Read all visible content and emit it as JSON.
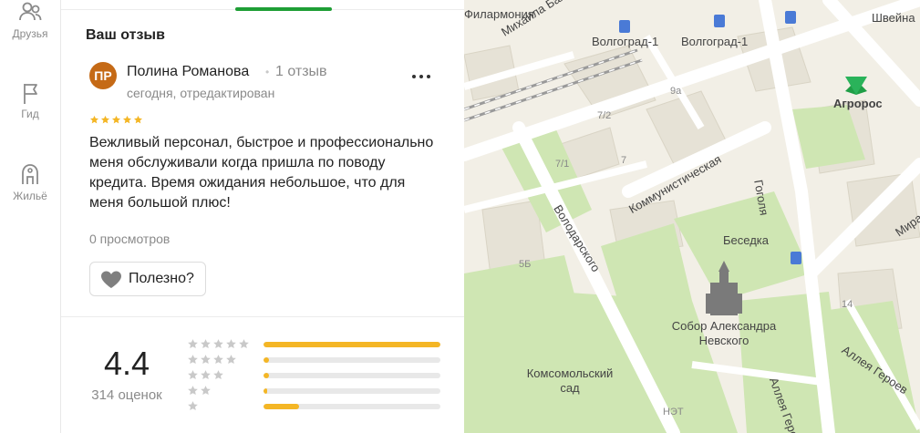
{
  "sidebar": {
    "items": [
      {
        "label": "Друзья",
        "icon": "friends-icon"
      },
      {
        "label": "Гид",
        "icon": "flag-icon"
      },
      {
        "label": "Жильё",
        "icon": "housing-icon"
      }
    ]
  },
  "review_section": {
    "title": "Ваш отзыв"
  },
  "review": {
    "avatar_initials": "ПР",
    "avatar_color": "#c56a16",
    "author": "Полина Романова",
    "author_reviews": "1 отзыв",
    "date": "сегодня, отредактирован",
    "stars": 5,
    "text": "Вежливый персонал, быстрое и профессионально меня обслуживали когда пришла по поводу кредита. Время ожидания небольшое, что для меня большой плюс!",
    "views": "0 просмотров",
    "helpful_label": "Полезно?"
  },
  "rating_summary": {
    "value": "4.4",
    "count_label": "314 оценок",
    "distribution": [
      {
        "stars": 5,
        "fraction": 1.0
      },
      {
        "stars": 4,
        "fraction": 0.03
      },
      {
        "stars": 3,
        "fraction": 0.03
      },
      {
        "stars": 2,
        "fraction": 0.02
      },
      {
        "stars": 1,
        "fraction": 0.2
      }
    ]
  },
  "colors": {
    "accent": "#1e9e35",
    "star": "#f4b625",
    "bar_fill": "#f4b625"
  },
  "map": {
    "labels": {
      "filarmonia": "Филармония",
      "balonina": "Михаила Балонина",
      "volgograd1_a": "Волгоград-1",
      "volgograd1_b": "Волгоград-1",
      "shveinaya": "Швейна",
      "n9a": "9а",
      "agroros": "Агророс",
      "n72": "7/2",
      "n71": "7/1",
      "n7": "7",
      "kommunisticheskaya": "Коммунистическая",
      "gogolya": "Гоголя",
      "mira": "Мира",
      "volodarskogo": "Володарского",
      "besedka": "Беседка",
      "n5b": "5Б",
      "n14": "14",
      "sobor": "Собор Александра Невского",
      "komsomolsky": "Комсомольский сад",
      "alleya1": "Аллея Героев",
      "alleya2": "Аллея Героев",
      "net": "НЭТ"
    }
  }
}
